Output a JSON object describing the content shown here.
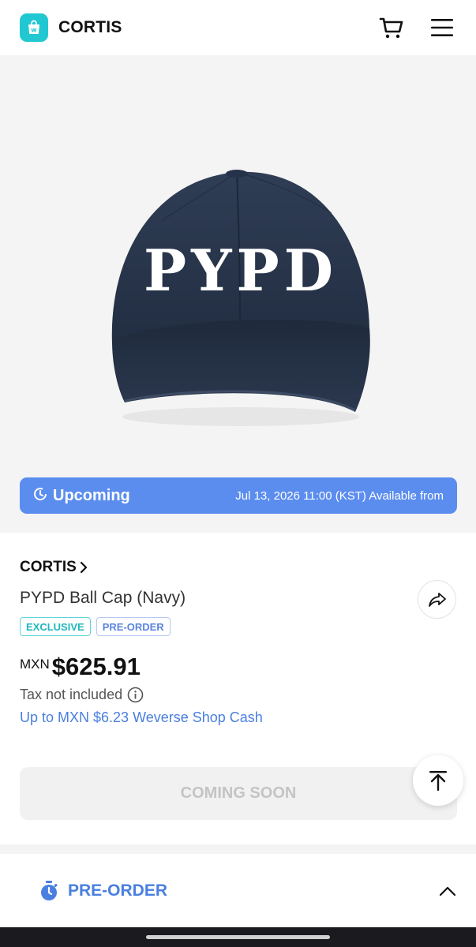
{
  "header": {
    "brand": "CORTIS",
    "logo_icon": "weverse-shop-bag-icon",
    "cart_icon": "cart-icon",
    "menu_icon": "hamburger-menu-icon"
  },
  "hero": {
    "image": "navy-ball-cap-product-image",
    "cap_text": "PYPD",
    "status": {
      "label": "Upcoming",
      "date": "Jul 13, 2026 11:00 (KST) Available from",
      "icon": "clock-icon",
      "color": "#5b8def"
    }
  },
  "product": {
    "artist": "CORTIS",
    "name": "PYPD Ball Cap (Navy)",
    "badges": [
      "EXCLUSIVE",
      "PRE-ORDER"
    ],
    "currency": "MXN",
    "price": "$625.91",
    "tax_note": "Tax not included",
    "cash_note": "Up to MXN $6.23 Weverse Shop Cash",
    "share_icon": "share-arrow-icon"
  },
  "actions": {
    "main_button": "COMING SOON",
    "top_icon": "scroll-to-top-icon"
  },
  "preorder": {
    "label": "PRE-ORDER",
    "icon": "stopwatch-icon"
  },
  "colors": {
    "accent_blue": "#4a7fe0",
    "brand_teal": "#21c8d2",
    "cap_navy": "#273448"
  }
}
